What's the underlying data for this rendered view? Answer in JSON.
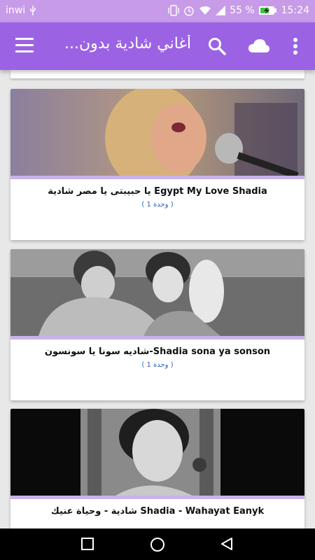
{
  "status_bar": {
    "carrier": "inwi",
    "usb_icon": "usb-icon",
    "battery": "55 %",
    "time": "15:24"
  },
  "app_bar": {
    "title": "أغاني شادية بدون...",
    "menu_icon": "hamburger-menu-icon",
    "search_icon": "search-icon",
    "cloud_icon": "cloud-icon",
    "overflow_icon": "more-vert-icon"
  },
  "items": [
    {
      "title": "يا حبيبتى يا مصر شادية Egypt My Love Shadia",
      "count": "( 1 وحدة )"
    },
    {
      "title": "شاديه سونا يا سونسون-Shadia sona ya sonson",
      "count": "( 1 وحدة )"
    },
    {
      "title": "شادية - وحياة عنيك Shadia - Wahayat Eanyk",
      "count": ""
    }
  ],
  "nav_bar": {
    "recent_icon": "square-recent-apps-icon",
    "home_icon": "circle-home-icon",
    "back_icon": "triangle-back-icon"
  }
}
